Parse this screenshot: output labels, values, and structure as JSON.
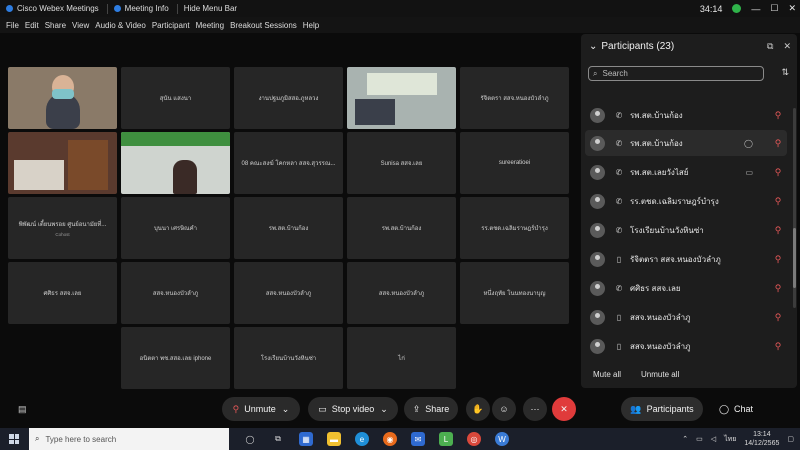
{
  "titlebar": {
    "items": [
      "Cisco Webex Meetings",
      "Meeting Info",
      "Hide Menu Bar"
    ],
    "time": "34:14"
  },
  "menu": [
    "File",
    "Edit",
    "Share",
    "View",
    "Audio & Video",
    "Participant",
    "Meeting",
    "Breakout Sessions",
    "Help"
  ],
  "tiles": [
    {
      "name": "",
      "video": true
    },
    {
      "name": "สุนัน แสงนา"
    },
    {
      "name": "งานปฐมภูมิสสอ.ภูหลวง"
    },
    {
      "name": "",
      "video": true
    },
    {
      "name": "รัจิตตรา สสจ.หนองบัวลำภู"
    },
    {
      "name": "",
      "video": true
    },
    {
      "name": "",
      "video": true
    },
    {
      "name": "08 คณะสงฆ์ โคกหลา สสจ.สุวรรณ..."
    },
    {
      "name": "Sunisa สสจ.เลย"
    },
    {
      "name": "sureeratioei"
    },
    {
      "name": "พิพัฒน์ เตี้ยนพรอย ศูนย์อนามัยที่...",
      "sub": "Cohost"
    },
    {
      "name": "บุนนา เศรษิณคำ"
    },
    {
      "name": "รพ.สต.บ้านก้อง"
    },
    {
      "name": "รพ.สต.บ้านก้อง"
    },
    {
      "name": "รร.ตชด.เฉลิมราษฎร์บำรุง"
    },
    {
      "name": "ศศิธร สสจ.เลย"
    },
    {
      "name": "สสจ.หนองบัวลำภู"
    },
    {
      "name": "สสจ.หนองบัวลำภู"
    },
    {
      "name": "สสจ.หนองบัวลำภู"
    },
    {
      "name": "หนึ่งฤทัย โนนทองนาบุญ"
    },
    {
      "name": "อนิตตา พช.สสอ.เลย iphone"
    },
    {
      "name": "โรงเรียนบ้านวังหินซ่า"
    },
    {
      "name": "ไก่"
    }
  ],
  "participants": {
    "title": "Participants (23)",
    "search_placeholder": "Search",
    "rows": [
      {
        "name": "รพ.สต.บ้านก้อง",
        "device": "phone",
        "extra": ""
      },
      {
        "name": "รพ.สต.บ้านก้อง",
        "device": "phone",
        "extra": "chat"
      },
      {
        "name": "รพ.สต.เลยวังไสย์",
        "device": "phone",
        "extra": "video"
      },
      {
        "name": "รร.ตชด.เฉลิมราษฎร์บำรุง",
        "device": "phone",
        "extra": ""
      },
      {
        "name": "โรงเรียนบ้านวังหินซ่า",
        "device": "phone",
        "extra": ""
      },
      {
        "name": "รัจิตตรา สสจ.หนองบัวลำภู",
        "device": "tablet",
        "extra": ""
      },
      {
        "name": "ศศิธร สสจ.เลย",
        "device": "phone",
        "extra": ""
      },
      {
        "name": "สสจ.หนองบัวลำภู",
        "device": "tablet",
        "extra": ""
      },
      {
        "name": "สสจ.หนองบัวลำภู",
        "device": "tablet",
        "extra": ""
      }
    ],
    "mute_all": "Mute all",
    "unmute_all": "Unmute all"
  },
  "controls": {
    "unmute": "Unmute",
    "stop_video": "Stop video",
    "share": "Share",
    "participants": "Participants",
    "chat": "Chat"
  },
  "taskbar": {
    "search_placeholder": "Type here to search",
    "lang": "ไทย",
    "time": "13:14",
    "date": "14/12/2565"
  }
}
